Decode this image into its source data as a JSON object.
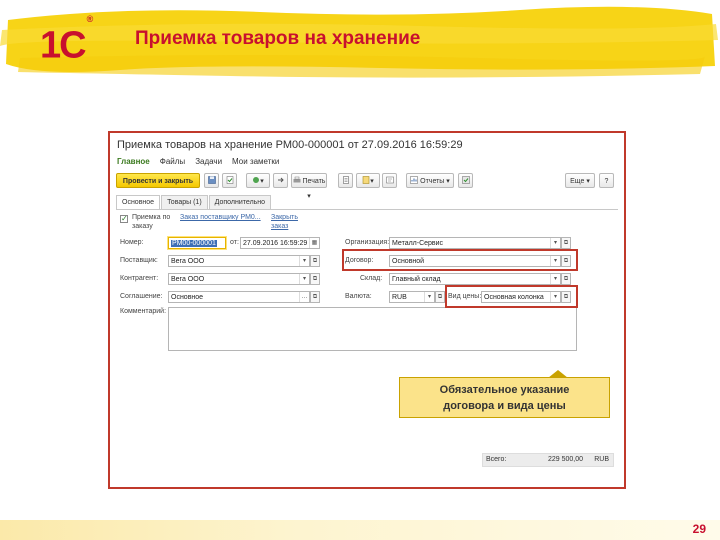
{
  "slide": {
    "logo": "1С",
    "logo_mark": "®",
    "title": "Приемка товаров на хранение",
    "page_number": "29"
  },
  "document": {
    "window_title": "Приемка товаров на хранение РМ00-000001 от 27.09.2016 16:59:29",
    "nav": [
      "Главное",
      "Файлы",
      "Задачи",
      "Мои заметки"
    ],
    "toolbar": {
      "post_close": "Провести и закрыть",
      "print": "Печать",
      "reports": "Отчеты",
      "more": "Еще",
      "help": "?"
    },
    "tabs": [
      "Основное",
      "Товары (1)",
      "Дополнительно"
    ],
    "checkbox_label_1": "Приемка по",
    "checkbox_label_2": "заказу",
    "order_link": "Заказ поставщику РМ0...",
    "clear_link_1": "Закрыть",
    "clear_link_2": "заказ",
    "number_label": "Номер:",
    "number_value": "РМ00-000001",
    "date_label": "от:",
    "date_value": "27.09.2016 16:59:29",
    "supplier_label": "Поставщик:",
    "supplier_value": "Вега ООО",
    "counterparty_label": "Контрагент:",
    "counterparty_value": "Вега ООО",
    "agreement_label": "Соглашение:",
    "agreement_value": "Основное",
    "comment_label": "Комментарий:",
    "org_label": "Организация:",
    "org_value": "Металл-Сервис",
    "contract_label": "Договор:",
    "contract_value": "Основной",
    "warehouse_label": "Склад:",
    "warehouse_value": "Главный склад",
    "currency_label": "Валюта:",
    "currency_value": "RUB",
    "price_type_label": "Вид цены:",
    "price_type_value": "Основная колонка",
    "total_label": "Всего:",
    "total_value": "229 500,00",
    "total_currency": "RUB"
  },
  "callout": {
    "line1": "Обязательное указание",
    "line2": "договора и вида цены"
  },
  "colors": {
    "brand_red": "#c8102e",
    "highlight_red": "#c0392b",
    "banner_yellow": "#f7d417",
    "callout_yellow": "#fbe38a"
  }
}
